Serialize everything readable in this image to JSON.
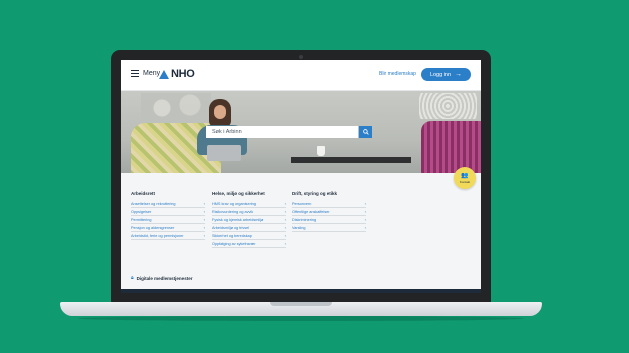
{
  "header": {
    "menu_label": "Meny",
    "logo_text": "NHO",
    "member_link": "Blir medlemskap",
    "login_label": "Logg inn"
  },
  "hero": {
    "search_placeholder": "Søk i Arbinn"
  },
  "contact": {
    "label": "Kontakt"
  },
  "columns": [
    {
      "title": "Arbeidsrett",
      "items": [
        "Ansettelser og rekruttering",
        "Oppsigelser",
        "Permittering",
        "Pensjon og aldersgrenser",
        "Arbeidstid, ferie og permisjoner"
      ]
    },
    {
      "title": "Helse, miljø og sikkerhet",
      "items": [
        "HMS krav og organisering",
        "Risikovurdering og avvik",
        "Fysisk og kjemisk arbeidsmiljø",
        "Arbeidsmiljø og trivsel",
        "Sikkerhet og beredskap",
        "Oppfølging av sykefravær"
      ]
    },
    {
      "title": "Drift, styring og etikk",
      "items": [
        "Personvern",
        "Offentlige anskaffelser",
        "Diskriminering",
        "Varsling"
      ]
    }
  ],
  "footer": {
    "digital_services": "Digitale medlemstjenester"
  },
  "colors": {
    "background": "#0f9a70",
    "accent": "#2b7ec8",
    "contact": "#f1d95a",
    "text": "#1d2b3a"
  },
  "icons": [
    "hamburger-icon",
    "nho-logo-icon",
    "arrow-right-icon",
    "search-icon",
    "contact-icon",
    "chevron-right-icon",
    "lock-icon"
  ]
}
